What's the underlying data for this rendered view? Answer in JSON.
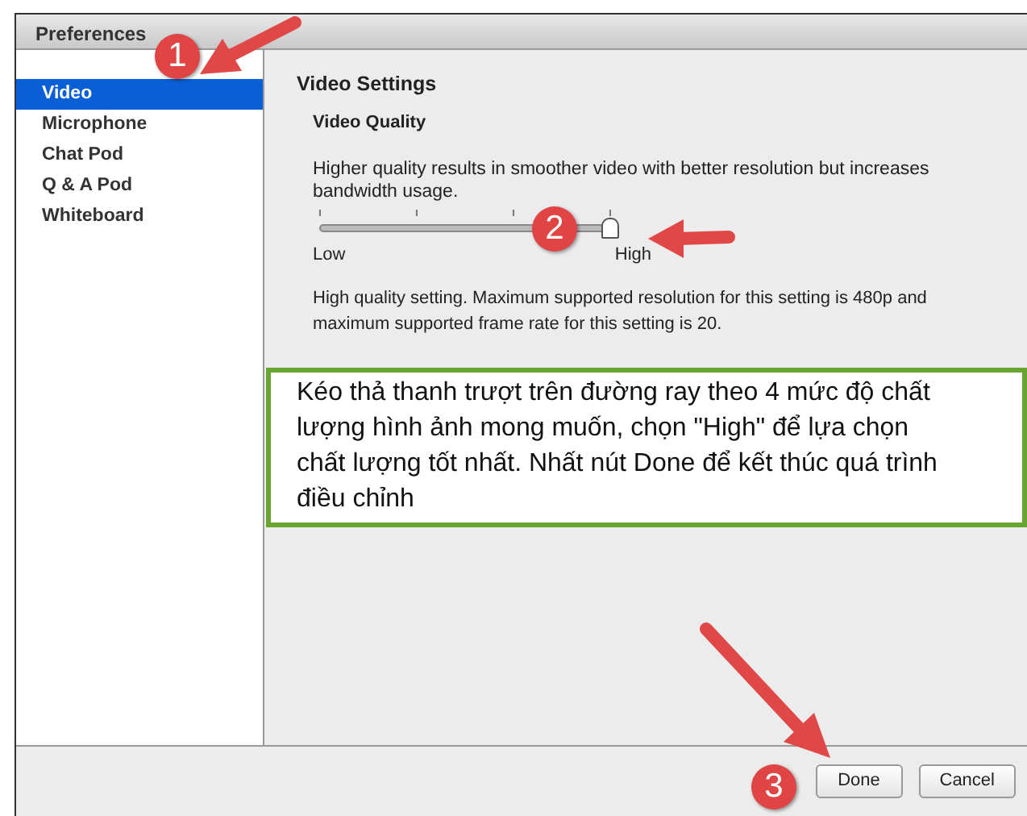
{
  "window": {
    "title": "Preferences"
  },
  "sidebar": {
    "items": [
      {
        "label": "Video",
        "selected": true
      },
      {
        "label": "Microphone",
        "selected": false
      },
      {
        "label": "Chat Pod",
        "selected": false
      },
      {
        "label": "Q & A Pod",
        "selected": false
      },
      {
        "label": "Whiteboard",
        "selected": false
      }
    ]
  },
  "content": {
    "heading": "Video Settings",
    "subheading": "Video Quality",
    "description": "Higher quality results in smoother video with better resolution but increases bandwidth usage.",
    "slider": {
      "level": 1.0,
      "min_label": "Low",
      "max_label": "High"
    },
    "note": "High quality setting. Maximum supported resolution for this setting is 480p and maximum supported frame rate for this setting is 20."
  },
  "callout": {
    "text": "Kéo thả thanh trượt trên đường ray theo 4 mức độ chất lượng hình ảnh mong muốn, chọn \"High\" để lựa chọn chất lượng tốt nhất. Nhất nút Done để kết thúc quá trình điều chỉnh"
  },
  "markers": [
    "1",
    "2",
    "3"
  ],
  "buttons": [
    "Done",
    "Cancel"
  ]
}
